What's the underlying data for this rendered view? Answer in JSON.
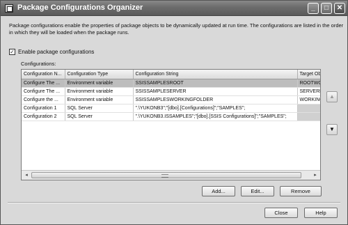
{
  "window": {
    "title": "Package Configurations Organizer",
    "controls": {
      "minimize": "_",
      "maximize": "□",
      "close": "✕"
    }
  },
  "description": {
    "line1": "Package configurations enable the properties of package objects to be dynamically updated at run time. The configurations are listed in the order",
    "line2": "in which they will be loaded when the package runs."
  },
  "enable": {
    "label": "Enable package configurations",
    "checked": true,
    "check_glyph": "✓"
  },
  "configurations_label": "Configurations:",
  "grid": {
    "columns": [
      "Configuration N...",
      "Configuration Type",
      "Configuration String",
      "Target Ob"
    ],
    "rows": [
      [
        "Configure The ...",
        "Environment variable",
        "SSISSAMPLESROOT",
        "ROOTWO"
      ],
      [
        "Configure The ...",
        "Environment variable",
        "SSISSAMPLESERVER",
        "SERVERNA"
      ],
      [
        "Configure the ...",
        "Environment variable",
        "SSISSAMPLESWORKINGFOLDER",
        "WORKING"
      ],
      [
        "Configuration 1",
        "SQL Server",
        "\".\\YUKONB3\";\"[dbo].[Configurations]\";\"SAMPLES\";",
        ""
      ],
      [
        "Configuration 2",
        "SQL Server",
        "\".\\YUKONB3.ISSAMPLES\";\"[dbo].[SSIS Configurations]\";\"SAMPLES\";",
        ""
      ]
    ],
    "selected_row": 0,
    "scroll_left": "◂",
    "scroll_right": "▸"
  },
  "side_buttons": {
    "up": "▲",
    "down": "▼"
  },
  "buttons": {
    "add": "Add...",
    "edit": "Edit...",
    "remove": "Remove",
    "close": "Close",
    "help": "Help"
  },
  "colors": {
    "titlebar": "#6e6e6e",
    "selected_row": "#bdbdbd",
    "dialog_bg": "#d9d9d9"
  }
}
